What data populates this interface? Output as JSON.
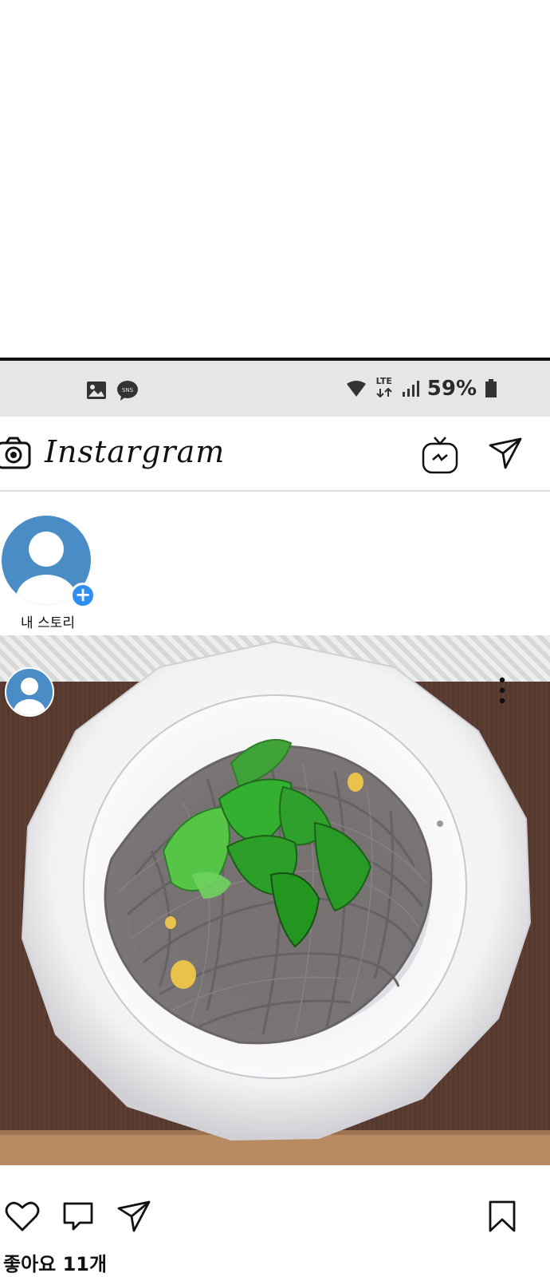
{
  "status_bar": {
    "notification_icons": [
      "image-icon",
      "sns-icon"
    ],
    "sns_label": "SNS",
    "network": "LTE",
    "battery": "59%"
  },
  "header": {
    "brand": "Instargram",
    "icons": [
      "camera-icon",
      "igtv-icon",
      "direct-message-icon"
    ]
  },
  "stories": [
    {
      "label": "내 스토리"
    }
  ],
  "post": {
    "image_description_icon": "soba-noodles-photo",
    "more_icon": "more-vertical-icon"
  },
  "actions": {
    "icons": [
      "heart-icon",
      "comment-icon",
      "share-icon",
      "bookmark-icon"
    ]
  },
  "likes_text": "좋아요 11개"
}
